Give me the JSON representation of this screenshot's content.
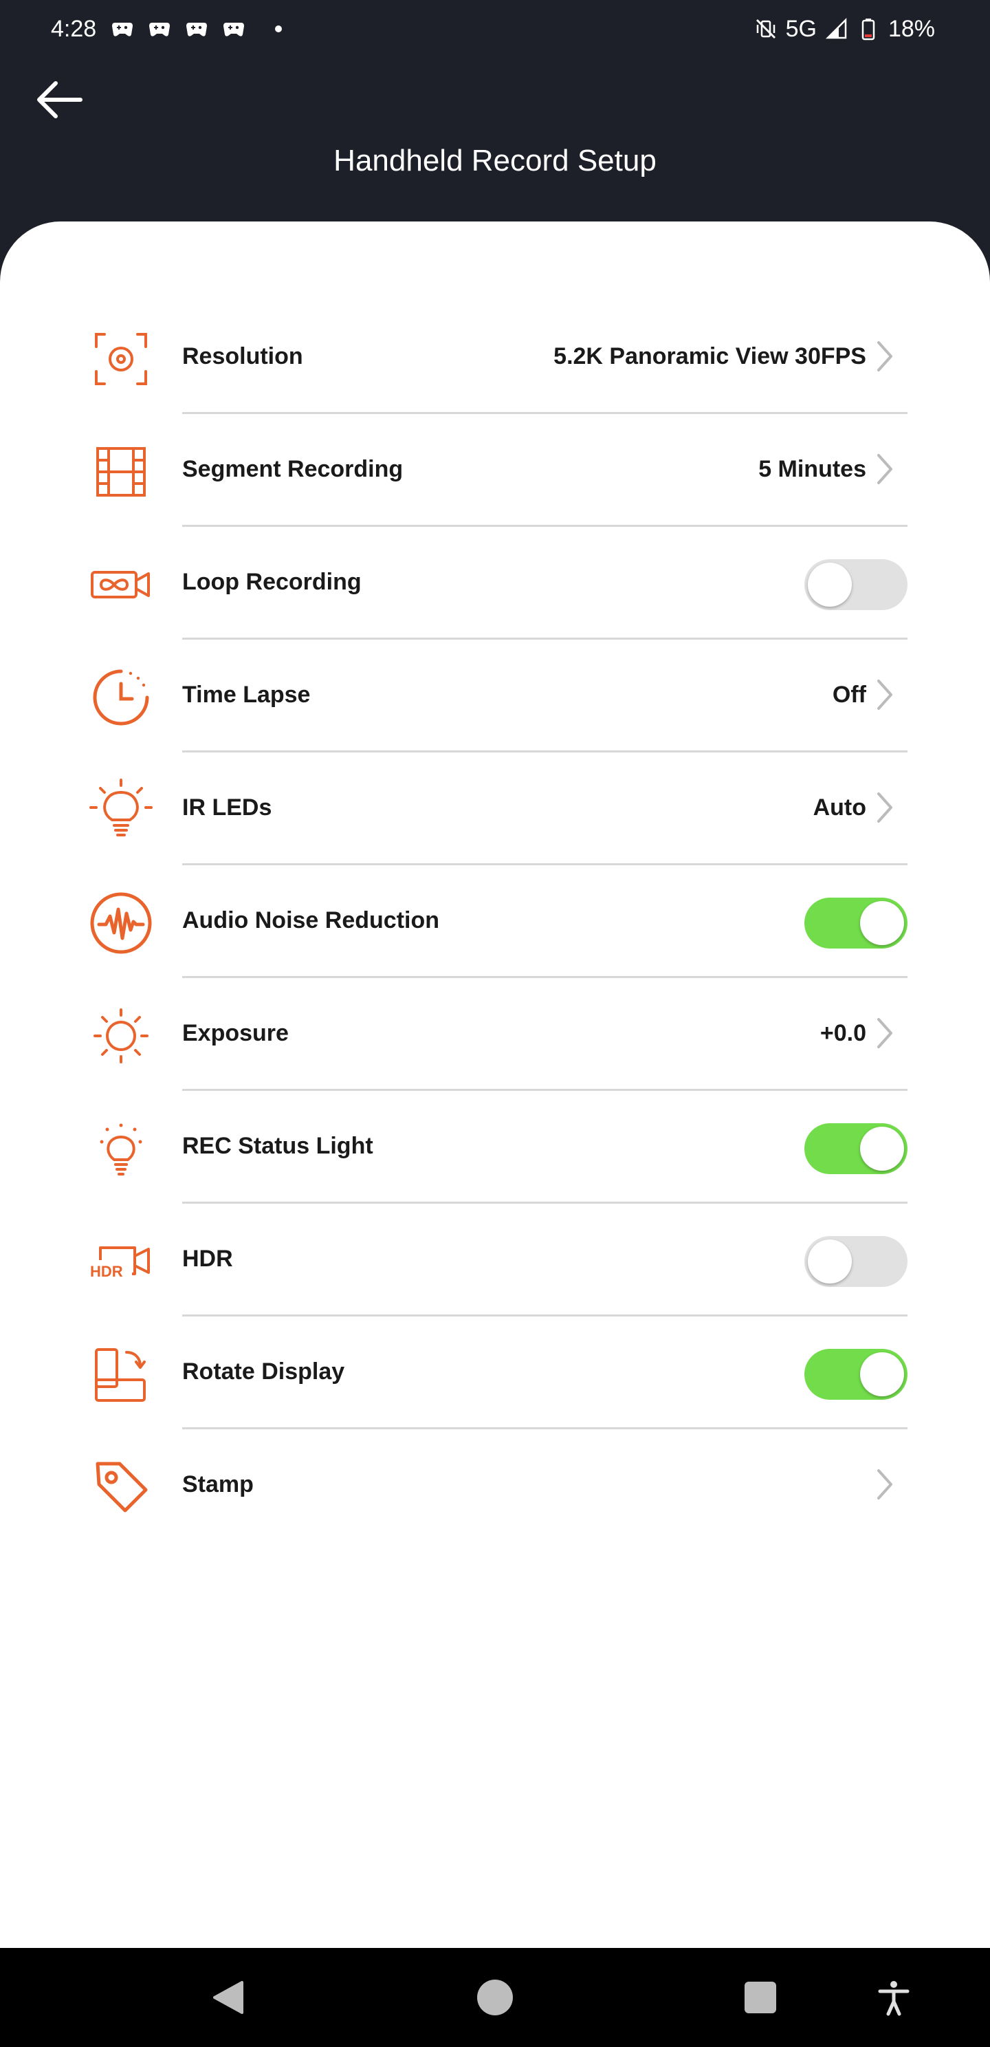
{
  "status_bar": {
    "time": "4:28",
    "network": "5G",
    "battery": "18%",
    "left_icons": [
      "game-controller-icon",
      "game-controller-icon",
      "game-controller-icon",
      "game-controller-icon",
      "notification-dot-icon"
    ],
    "right_icons": [
      "vibrate-off-icon",
      "signal-icon",
      "battery-icon"
    ]
  },
  "header": {
    "title": "Handheld Record Setup",
    "back_icon": "back-arrow-icon"
  },
  "colors": {
    "accent": "#E8642C",
    "toggle_on": "#72DC4A",
    "toggle_off": "#E1E1E1",
    "header_bg": "#1E2029",
    "chevron": "#BBBBBB"
  },
  "settings": [
    {
      "label": "Resolution",
      "value": "5.2K Panoramic View 30FPS",
      "control": "chevron",
      "icon": "focus-target-icon"
    },
    {
      "label": "Segment Recording",
      "value": "5 Minutes",
      "control": "chevron",
      "icon": "film-strip-icon"
    },
    {
      "label": "Loop Recording",
      "value": "",
      "control": "toggle",
      "toggle_on": false,
      "icon": "loop-camera-icon"
    },
    {
      "label": "Time Lapse",
      "value": "Off",
      "control": "chevron",
      "icon": "clock-icon"
    },
    {
      "label": "IR LEDs",
      "value": "Auto",
      "control": "chevron",
      "icon": "light-bulb-icon"
    },
    {
      "label": "Audio Noise Reduction",
      "value": "",
      "control": "toggle",
      "toggle_on": true,
      "icon": "audio-wave-icon"
    },
    {
      "label": "Exposure",
      "value": "+0.0",
      "control": "chevron",
      "icon": "sun-icon"
    },
    {
      "label": "REC Status Light",
      "value": "",
      "control": "toggle",
      "toggle_on": true,
      "icon": "status-light-icon"
    },
    {
      "label": "HDR",
      "value": "",
      "control": "toggle",
      "toggle_on": false,
      "icon": "hdr-camera-icon"
    },
    {
      "label": "Rotate Display",
      "value": "",
      "control": "toggle",
      "toggle_on": true,
      "icon": "rotate-display-icon"
    },
    {
      "label": "Stamp",
      "value": "",
      "control": "chevron",
      "icon": "tag-icon"
    }
  ],
  "nav_bar": {
    "icons": [
      "nav-back-icon",
      "nav-home-icon",
      "nav-recents-icon",
      "accessibility-icon"
    ]
  }
}
